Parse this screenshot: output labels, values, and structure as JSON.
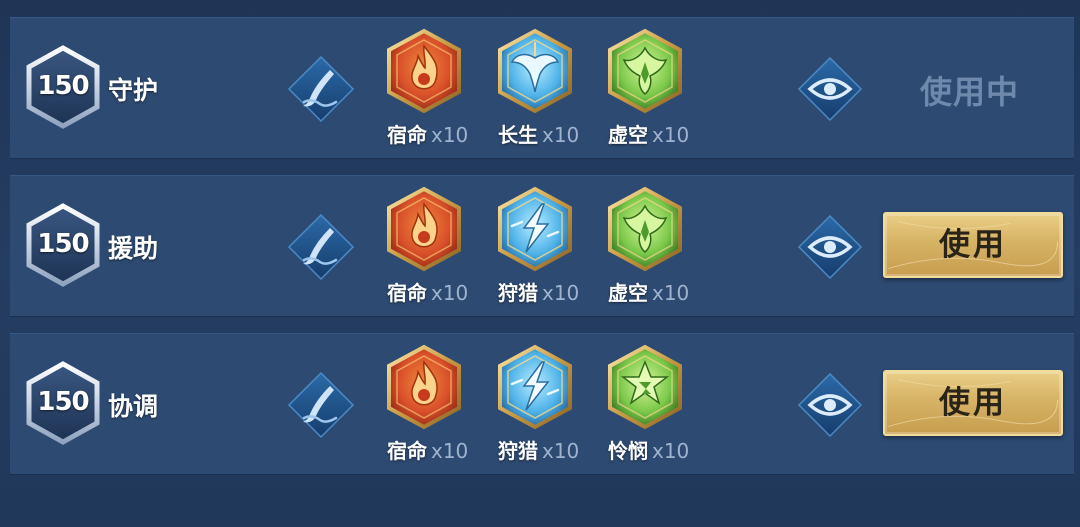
{
  "colors": {
    "fire": "#d9502a",
    "water": "#4fb3e8",
    "nature": "#7bc94a",
    "gold": "#d6b365"
  },
  "rows": [
    {
      "level": "150",
      "name": "守护",
      "emblems": [
        {
          "name": "宿命",
          "count": "x10",
          "icon": "flame-emblem-icon"
        },
        {
          "name": "长生",
          "count": "x10",
          "icon": "wing-emblem-icon"
        },
        {
          "name": "虚空",
          "count": "x10",
          "icon": "void-emblem-icon"
        }
      ],
      "status": "使用中"
    },
    {
      "level": "150",
      "name": "援助",
      "emblems": [
        {
          "name": "宿命",
          "count": "x10",
          "icon": "flame-emblem-icon"
        },
        {
          "name": "狩猎",
          "count": "x10",
          "icon": "lightning-emblem-icon"
        },
        {
          "name": "虚空",
          "count": "x10",
          "icon": "void-emblem-icon"
        }
      ],
      "button": "使用"
    },
    {
      "level": "150",
      "name": "协调",
      "emblems": [
        {
          "name": "宿命",
          "count": "x10",
          "icon": "flame-emblem-icon"
        },
        {
          "name": "狩猎",
          "count": "x10",
          "icon": "lightning-emblem-icon"
        },
        {
          "name": "怜悯",
          "count": "x10",
          "icon": "star-emblem-icon"
        }
      ],
      "button": "使用"
    }
  ]
}
